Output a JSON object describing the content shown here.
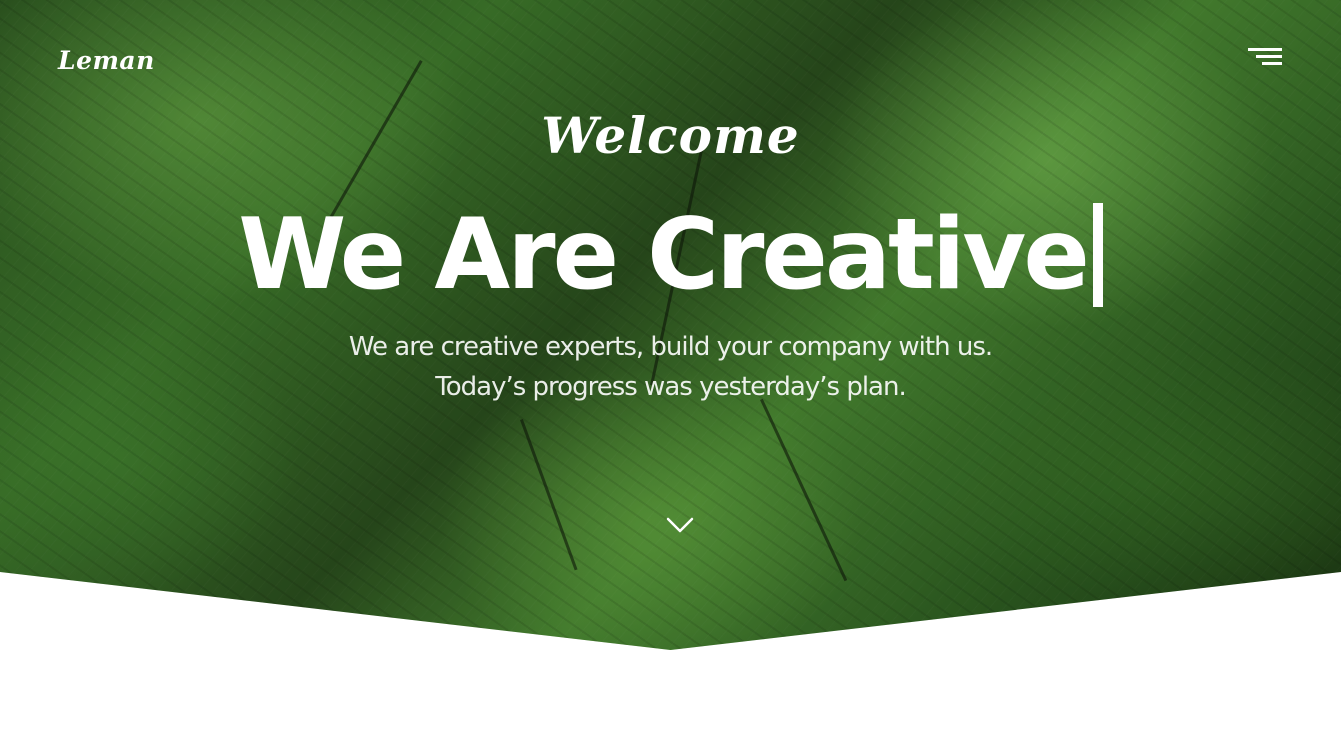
{
  "header": {
    "logo": "Leman",
    "menu_icon": "hamburger-menu-icon"
  },
  "hero": {
    "welcome": "Welcome",
    "headline": "We Are Creative",
    "subtitle_line1": "We are creative experts, build your company with us.",
    "subtitle_line2": "Today’s progress was yesterday’s plan.",
    "scroll_icon": "chevron-down-icon"
  },
  "colors": {
    "text": "#ffffff",
    "background_bottom": "#ffffff",
    "hero_green": "#3f7a2c"
  }
}
